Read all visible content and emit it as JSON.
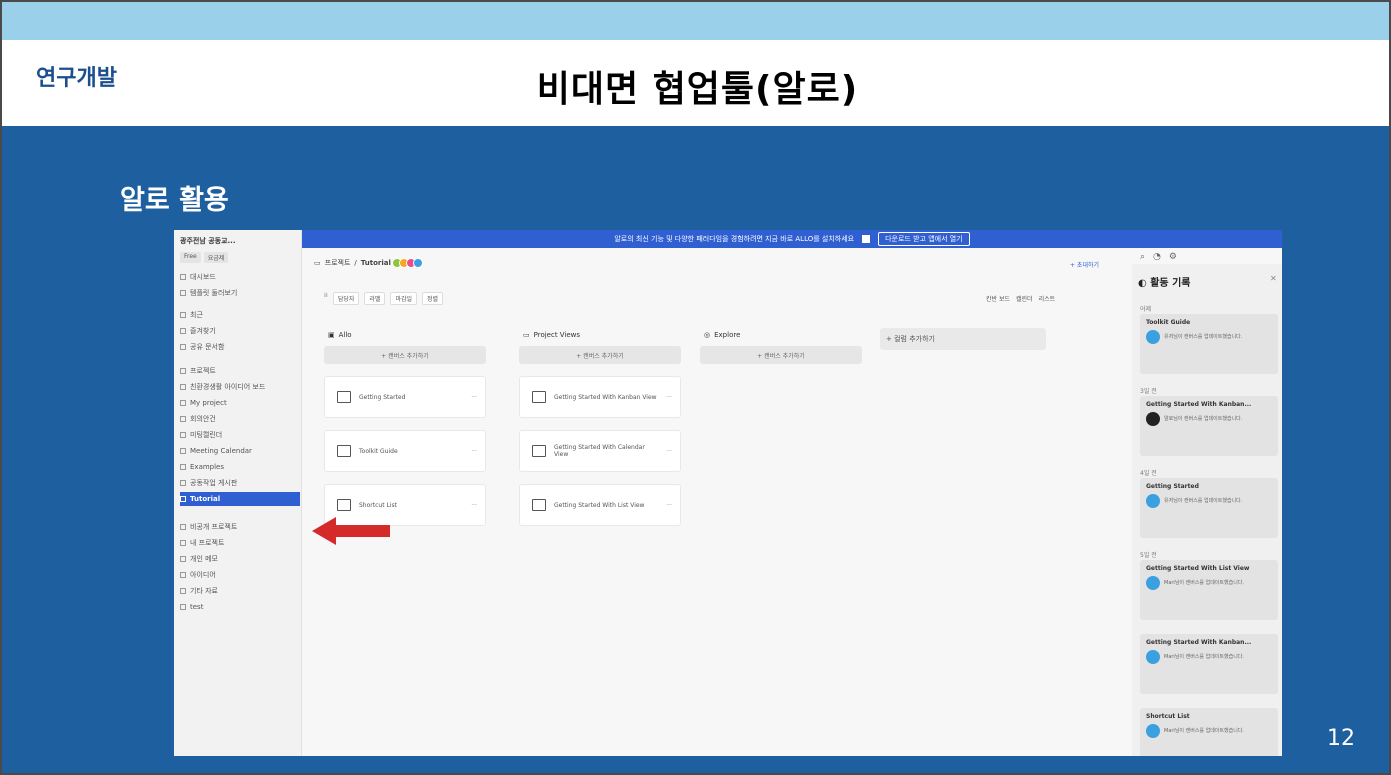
{
  "slide": {
    "section_label": "연구개발",
    "title": "비대면 협업툴(알로)",
    "subtitle": "알로 활용",
    "page_number": "12"
  },
  "colors": {
    "top_strip": "#9ad0ea",
    "blue_area": "#1e5fa0",
    "accent": "#2f5fd0",
    "arrow": "#d42a2a"
  },
  "app": {
    "notice": {
      "text": "알로의 최신 기능 및 다양한 패러다임을 경험하려면 지금 바로 ALLO를 설치하세요",
      "button": "다운로드 받고 앱에서 열기"
    },
    "sidebar": {
      "workspace": "광주전남 공동교...",
      "chips": [
        "Free",
        "요금제"
      ],
      "items": [
        {
          "label": "대시보드",
          "selected": false
        },
        {
          "label": "템플릿 둘러보기",
          "selected": false
        },
        {
          "label": "최근",
          "selected": false
        },
        {
          "label": "즐겨찾기",
          "selected": false
        },
        {
          "label": "공유 문서함",
          "selected": false
        },
        {
          "label": "프로젝트",
          "selected": false
        },
        {
          "label": "친환경생활 아이디어 보드",
          "selected": false
        },
        {
          "label": "My project",
          "selected": false
        },
        {
          "label": "회의안건",
          "selected": false
        },
        {
          "label": "미팅캘린더",
          "selected": false
        },
        {
          "label": "Meeting Calendar",
          "selected": false
        },
        {
          "label": "Examples",
          "selected": false
        },
        {
          "label": "공동작업 게시판",
          "selected": false
        },
        {
          "label": "Tutorial",
          "selected": true
        },
        {
          "label": "비공개 프로젝트",
          "selected": false
        },
        {
          "label": "내 프로젝트",
          "selected": false
        },
        {
          "label": "개인 메모",
          "selected": false
        },
        {
          "label": "아이디어",
          "selected": false
        },
        {
          "label": "기타 자료",
          "selected": false
        },
        {
          "label": "test",
          "selected": false
        }
      ]
    },
    "breadcrumb": {
      "project": "프로젝트",
      "board": "Tutorial"
    },
    "filters": [
      "담당자",
      "라벨",
      "마감일",
      "정렬"
    ],
    "invite_label": "+ 초대하기",
    "view_toggles": [
      "칸반 보드",
      "캘린더",
      "리스트"
    ],
    "columns": [
      {
        "name": "Allo",
        "add_label": "+ 캔버스 추가하기",
        "cards": [
          "Getting Started",
          "Toolkit Guide",
          "Shortcut List"
        ]
      },
      {
        "name": "Project Views",
        "add_label": "+ 캔버스 추가하기",
        "cards": [
          "Getting Started With Kanban View",
          "Getting Started With Calendar View",
          "Getting Started With List View"
        ]
      },
      {
        "name": "Explore",
        "add_label": "+ 캔버스 추가하기",
        "cards": []
      }
    ],
    "add_column_label": "+ 컬럼 추가하기",
    "activity": {
      "title": "활동 기록",
      "groups": [
        {
          "date": "어제",
          "item": "Toolkit Guide",
          "text": "유저님이 캔버스를 업데이트했습니다."
        },
        {
          "date": "3일 전",
          "item": "Getting Started With Kanban...",
          "text": "알로님이 캔버스를 업데이트했습니다."
        },
        {
          "date": "4일 전",
          "item": "Getting Started",
          "text": "유저님이 캔버스를 업데이트했습니다."
        },
        {
          "date": "5일 전",
          "item": "Getting Started With List View",
          "text": "Mari님이 캔버스를 업데이트했습니다."
        },
        {
          "date": "",
          "item": "Getting Started With Kanban...",
          "text": "Mari님이 캔버스를 업데이트했습니다."
        },
        {
          "date": "",
          "item": "Shortcut List",
          "text": "Mari님이 캔버스를 업데이트했습니다."
        }
      ]
    }
  }
}
